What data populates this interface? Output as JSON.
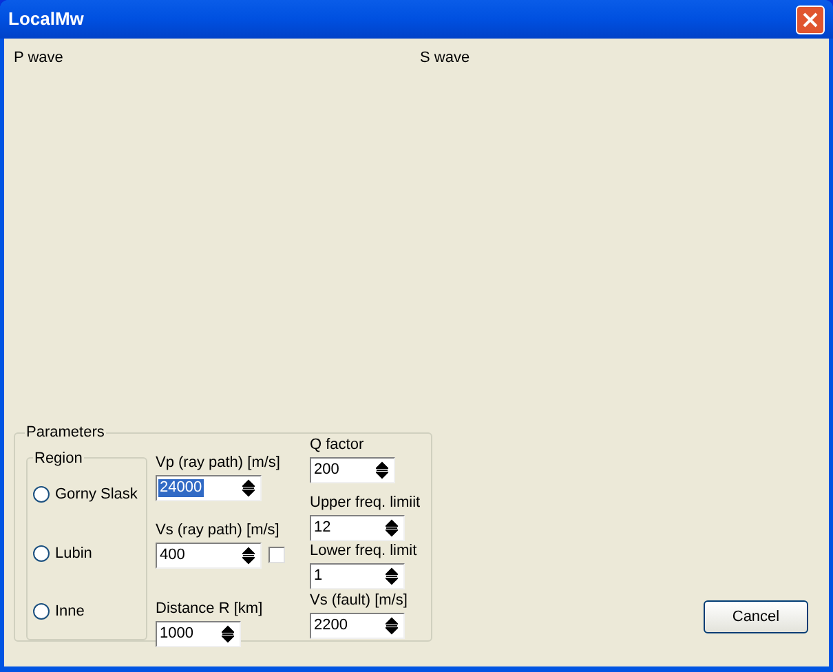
{
  "window": {
    "title": "LocalMw"
  },
  "panels": [
    {
      "label": "P wave"
    },
    {
      "label": "S wave"
    }
  ],
  "parameters": {
    "title": "Parameters",
    "region": {
      "title": "Region",
      "options": [
        {
          "label": "Gorny Slask",
          "checked": false
        },
        {
          "label": "Lubin",
          "checked": false
        },
        {
          "label": "Inne",
          "checked": false
        }
      ]
    },
    "columns": [
      [
        {
          "label": "Vp (ray path) [m/s]",
          "value": "24000",
          "highlighted": true
        },
        {
          "label": "Vs (ray path) [m/s]",
          "value": "400",
          "highlighted": false,
          "checkbox": {
            "checked": false
          }
        },
        {
          "label": "Distance R [km]",
          "value": "1000",
          "highlighted": false
        }
      ],
      [
        {
          "label": "Q factor",
          "value": "200",
          "highlighted": false
        },
        {
          "label": "Upper freq. limiit",
          "value": "12",
          "highlighted": false
        },
        {
          "label": "Lower freq. limit",
          "value": "1",
          "highlighted": false
        },
        {
          "label": "Vs (fault) [m/s]",
          "value": "2200",
          "highlighted": false
        }
      ]
    ]
  },
  "buttons": [
    {
      "label": "Cancel"
    }
  ]
}
